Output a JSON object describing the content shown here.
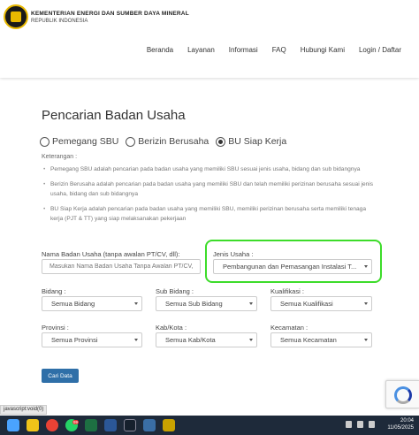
{
  "header": {
    "org_name": "KEMENTERIAN ENERGI DAN SUMBER DAYA MINERAL",
    "org_sub": "REPUBLIK INDONESIA",
    "nav": [
      "Beranda",
      "Layanan",
      "Informasi",
      "FAQ",
      "Hubungi Kami",
      "Login / Daftar"
    ]
  },
  "page": {
    "title": "Pencarian Badan Usaha",
    "radios": [
      {
        "label": "Pemegang SBU",
        "checked": false
      },
      {
        "label": "Berizin Berusaha",
        "checked": false
      },
      {
        "label": "BU Siap Kerja",
        "checked": true
      }
    ],
    "note_label": "Keterangan :",
    "notes": [
      "Pemegang SBU adalah pencarian pada badan usaha yang memiliki SBU sesuai jenis usaha, bidang dan sub bidangnya",
      "Berizin Berusaha adalah pencarian pada badan usaha yang memiliki SBU dan telah memiliki perizinan berusaha sesuai jenis usaha, bidang dan sub bidangnya",
      "BU Siap Kerja adalah pencarian pada badan usaha yang memiliki SBU, memiliki perizinan berusaha serta memiliki tenaga kerja (PJT & TT) yang siap melaksanakan pekerjaan"
    ]
  },
  "form": {
    "nama_label": "Nama Badan Usaha (tanpa awalan PT/CV, dll):",
    "nama_placeholder": "Masukan Nama Badan Usaha Tanpa Awalan PT/CV, dll",
    "jenis_label": "Jenis Usaha :",
    "jenis_value": "Pembangunan dan Pemasangan Instalasi T...",
    "bidang_label": "Bidang :",
    "bidang_value": "Semua Bidang",
    "subbidang_label": "Sub Bidang :",
    "subbidang_value": "Semua Sub Bidang",
    "kualifikasi_label": "Kualifikasi :",
    "kualifikasi_value": "Semua Kualifikasi",
    "provinsi_label": "Provinsi :",
    "provinsi_value": "Semua Provinsi",
    "kabkota_label": "Kab/Kota :",
    "kabkota_value": "Semua Kab/Kota",
    "kecamatan_label": "Kecamatan :",
    "kecamatan_value": "Semua Kecamatan",
    "submit_label": "Cari Data"
  },
  "statusbar": "javascript:void(0)",
  "taskbar": {
    "time": "20:04",
    "date": "11/05/2025",
    "badge": "99"
  },
  "colors": {
    "primary_button": "#2f6fa8",
    "highlight": "#3ddc2a",
    "taskbar": "#1e2a3a"
  }
}
